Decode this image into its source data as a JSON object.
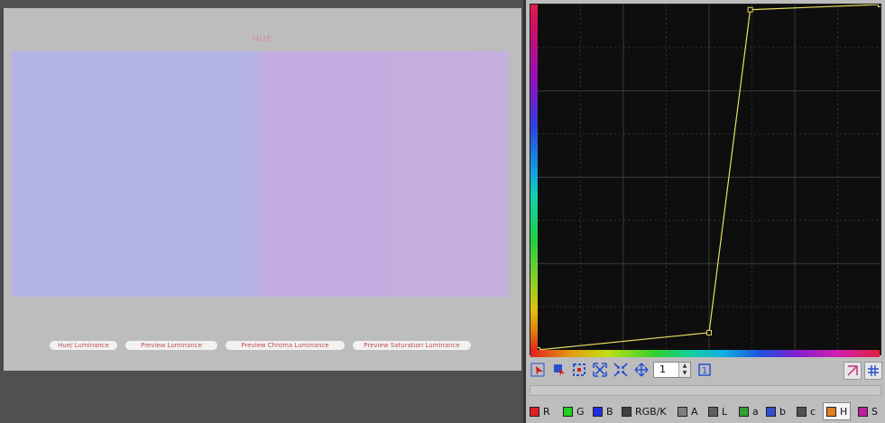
{
  "preview": {
    "swatch_title": "HUE",
    "buttons": [
      "Hue/ Luminance",
      "Preview Luminance",
      "Preview Chroma Luminance",
      "Preview Saturation Luminance"
    ],
    "swatch_colors": [
      "#b3b3e6",
      "#c5b0e0"
    ]
  },
  "curve_editor": {
    "curve_color": "#e8e060",
    "grid_color": "#3a3a3a",
    "background_color": "#0e0e0e",
    "points": [
      [
        0.0,
        0.0
      ],
      [
        0.5,
        0.05
      ],
      [
        0.62,
        0.985
      ],
      [
        1.0,
        1.0
      ]
    ]
  },
  "toolbar": {
    "icons": [
      "edit-points-icon",
      "select-point-icon",
      "crop-icon",
      "expand-icon",
      "collapse-icon",
      "move-icon"
    ],
    "spin_value": "1",
    "mode_icon_label": "1",
    "right_icons": [
      "reset-curve-icon",
      "grid-toggle-icon"
    ]
  },
  "channels": [
    {
      "label": "R",
      "color": "#e02020"
    },
    {
      "label": "G",
      "color": "#20d020"
    },
    {
      "label": "B",
      "color": "#2030e0"
    },
    {
      "label": "RGB/K",
      "color": "#404040"
    },
    {
      "label": "A",
      "color": "#808080"
    },
    {
      "label": "L",
      "color": "#606060"
    },
    {
      "label": "a",
      "color": "#30a030"
    },
    {
      "label": "b",
      "color": "#3050d0"
    },
    {
      "label": "c",
      "color": "#505050"
    },
    {
      "label": "H",
      "color": "#e08020",
      "active": true
    },
    {
      "label": "S",
      "color": "#c020a0"
    }
  ]
}
